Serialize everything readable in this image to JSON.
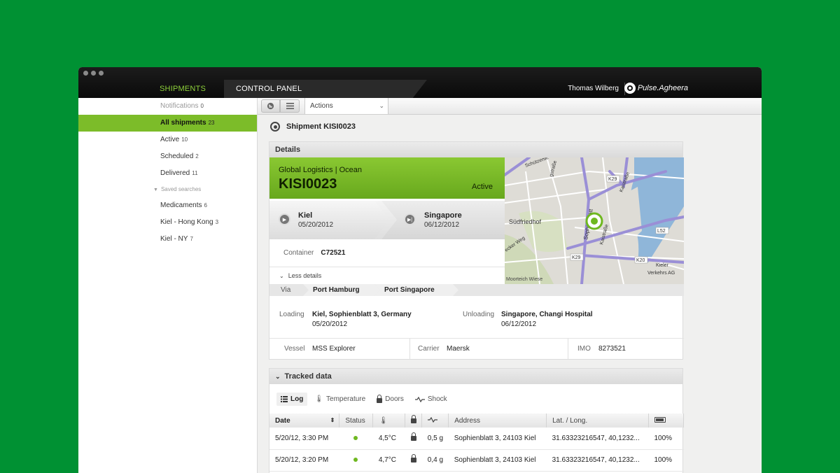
{
  "nav": {
    "tabs": [
      {
        "label": "SHIPMENTS"
      },
      {
        "label": "CONTROL PANEL"
      }
    ],
    "user": "Thomas Wilberg",
    "brand": "Pulse.Agheera"
  },
  "sidebar": {
    "items": [
      {
        "label": "Notifications",
        "count": "0"
      },
      {
        "label": "All shipments",
        "count": "23"
      },
      {
        "label": "Active",
        "count": "10"
      },
      {
        "label": "Scheduled",
        "count": "2"
      },
      {
        "label": "Delivered",
        "count": "11"
      }
    ],
    "saved_label": "Saved searches",
    "saved": [
      {
        "label": "Medicaments",
        "count": "6"
      },
      {
        "label": "Kiel - Hong Kong",
        "count": "3"
      },
      {
        "label": "Kiel - NY",
        "count": "7"
      }
    ]
  },
  "toolbar": {
    "actions_label": "Actions"
  },
  "shipment": {
    "title": "Shipment KISI0023",
    "details_label": "Details",
    "company": "Global Logistics | Ocean",
    "code": "KISI0023",
    "status": "Active",
    "from": {
      "city": "Kiel",
      "date": "05/20/2012"
    },
    "to": {
      "city": "Singapore",
      "date": "06/12/2012"
    },
    "container_label": "Container",
    "container": "C72521",
    "less_details": "Less details",
    "via_label": "Via",
    "via": [
      "Port Hamburg",
      "Port Singapore"
    ],
    "loading_label": "Loading",
    "loading_place": "Kiel, Sophienblatt 3, Germany",
    "loading_date": "05/20/2012",
    "unloading_label": "Unloading",
    "unloading_place": "Singapore, Changi Hospital",
    "unloading_date": "06/12/2012",
    "vessel_label": "Vessel",
    "vessel": "MSS Explorer",
    "carrier_label": "Carrier",
    "carrier": "Maersk",
    "imo_label": "IMO",
    "imo": "8273521"
  },
  "map": {
    "labels": {
      "sudfriedhof": "Südfriedhof",
      "moorteich": "Moorteich Wiese",
      "kieler": "Kieler",
      "verkehrs": "Verkehrs AG",
      "k29a": "K29",
      "k29b": "K29",
      "k20": "K20",
      "l52": "L52",
      "kaistr": "Kaistraße",
      "kaistr2": "Kaistraße",
      "sophienblatt": "Sophienblatt",
      "schutzen": "Schützenw.",
      "weg": "ecker Weg",
      "str": "gstraße"
    }
  },
  "tracked": {
    "label": "Tracked data",
    "tabs": [
      "Log",
      "Temperature",
      "Doors",
      "Shock"
    ],
    "columns": [
      "Date",
      "Status",
      "",
      "",
      "",
      "Address",
      "Lat. / Long.",
      ""
    ],
    "rows": [
      {
        "date": "5/20/12, 3:30 PM",
        "temp": "4,5°C",
        "shock": "0,5 g",
        "address": "Sophienblatt 3, 24103 Kiel",
        "latlong": "31.63323216547, 40,1232...",
        "battery": "100%"
      },
      {
        "date": "5/20/12, 3:20 PM",
        "temp": "4,7°C",
        "shock": "0,4 g",
        "address": "Sophienblatt 3, 24103 Kiel",
        "latlong": "31.63323216547, 40,1232...",
        "battery": "100%"
      }
    ]
  },
  "colors": {
    "background": "#009133",
    "accent": "#7cbc29",
    "card": "#67a81d",
    "titlebar": "#111111"
  }
}
